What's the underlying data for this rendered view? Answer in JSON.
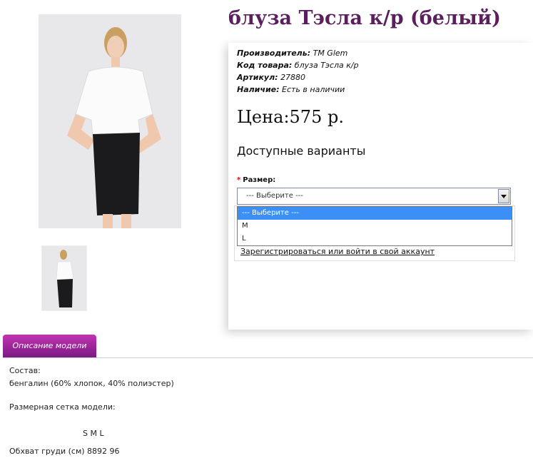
{
  "product": {
    "title": "блуза Тэсла к/р (белый)",
    "info": [
      {
        "label": "Производитель:",
        "value": "TM Glem"
      },
      {
        "label": "Код товара:",
        "value": "блуза Тэсла к/р"
      },
      {
        "label": "Артикул:",
        "value": "27880"
      },
      {
        "label": "Наличие:",
        "value": "Есть в наличии"
      }
    ],
    "price": "Цена:575 р."
  },
  "options": {
    "heading": "Доступные варианты",
    "size_label": "Размер:",
    "required_mark": "*",
    "select_value": "--- Выберите ---",
    "dropdown": [
      "--- Выберите ---",
      "M",
      "L"
    ]
  },
  "login_link": "Зарегистрироваться или войти в свой аккаунт",
  "tabs": {
    "active_label": "Описание модели"
  },
  "description": {
    "composition_label": "Состав:",
    "composition_value": "бенгалин (60% хлопок, 40% полиэстер)",
    "size_chart_label": "Размерная сетка модели:",
    "size_header": "S  M  L",
    "chest_row": "Обхват груди (см) 8892 96"
  },
  "colors": {
    "title": "#5b1f5e",
    "tab": "#9b25a0",
    "highlight": "#3b8ff5"
  }
}
